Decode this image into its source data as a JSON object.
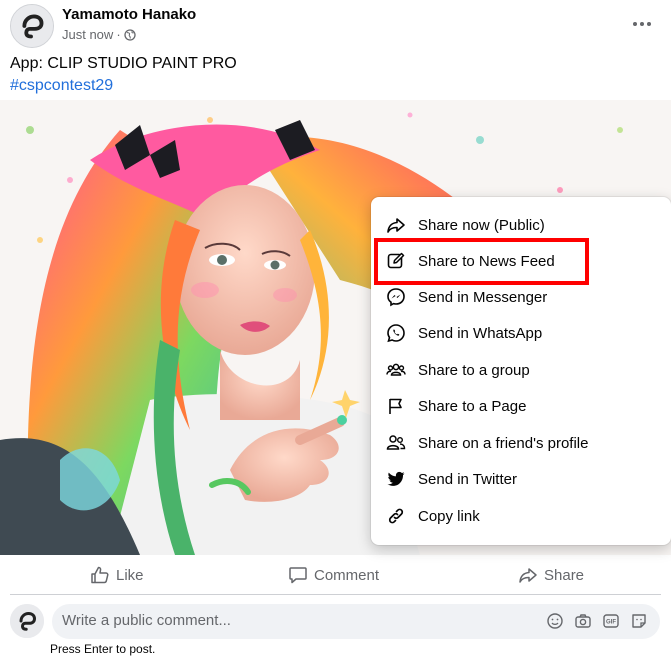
{
  "post": {
    "author": "Yamamoto Hanako",
    "timestamp": "Just now",
    "separator": "·",
    "privacy_icon": "globe-icon",
    "more_icon": "more-options-icon",
    "app_line": "App: CLIP STUDIO PAINT PRO",
    "hashtag": "#cspcontest29",
    "image_description_icon": "artwork-image"
  },
  "share_menu": {
    "items": [
      {
        "label": "Share now (Public)",
        "icon": "share-arrow-icon"
      },
      {
        "label": "Share to News Feed",
        "icon": "edit-icon"
      },
      {
        "label": "Send in Messenger",
        "icon": "messenger-icon"
      },
      {
        "label": "Send in WhatsApp",
        "icon": "whatsapp-icon"
      },
      {
        "label": "Share to a group",
        "icon": "group-icon"
      },
      {
        "label": "Share to a Page",
        "icon": "flag-icon"
      },
      {
        "label": "Share on a friend's profile",
        "icon": "friends-icon"
      },
      {
        "label": "Send in Twitter",
        "icon": "twitter-icon"
      },
      {
        "label": "Copy link",
        "icon": "link-icon"
      }
    ],
    "highlighted_item": "Share to News Feed",
    "highlight_color": "#ff0000"
  },
  "actions": {
    "like": "Like",
    "comment": "Comment",
    "share": "Share"
  },
  "comment": {
    "placeholder": "Write a public comment...",
    "hint": "Press Enter to post.",
    "icons": [
      "emoji-icon",
      "camera-icon",
      "gif-icon",
      "sticker-icon"
    ]
  },
  "colors": {
    "link_blue": "#216fdb",
    "secondary_text": "#65676b",
    "input_bg": "#f0f2f5"
  }
}
